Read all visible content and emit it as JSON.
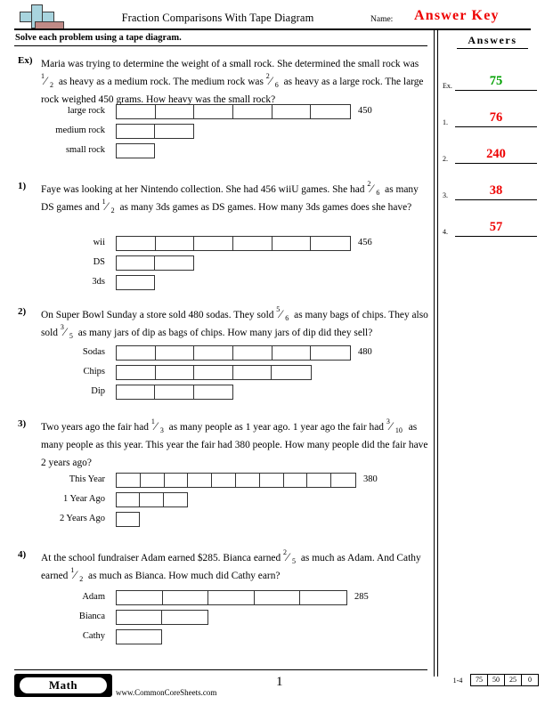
{
  "header": {
    "title": "Fraction Comparisons With Tape Diagram",
    "name_label": "Name:",
    "answer_key_label": "Answer Key",
    "logo_name": "commoncoresheets-logo"
  },
  "instruction": "Solve each problem using a tape diagram.",
  "answers": {
    "title": "Answers",
    "rows": [
      {
        "num": "Ex.",
        "value": "75",
        "color": "#00a000"
      },
      {
        "num": "1.",
        "value": "76",
        "color": "#ee0000"
      },
      {
        "num": "2.",
        "value": "240",
        "color": "#ee0000"
      },
      {
        "num": "3.",
        "value": "38",
        "color": "#ee0000"
      },
      {
        "num": "4.",
        "value": "57",
        "color": "#ee0000"
      }
    ]
  },
  "problems": [
    {
      "num": "Ex)",
      "text_parts": [
        {
          "t": "Maria was trying to determine the weight of a small rock. She determined the small rock was "
        },
        {
          "f": {
            "n": "1",
            "d": "2"
          }
        },
        {
          "t": " as heavy as a medium rock. The medium rock was "
        },
        {
          "f": {
            "n": "2",
            "d": "6"
          }
        },
        {
          "t": " as heavy as a large rock. The large rock weighed 450 grams. How heavy was the small rock?"
        }
      ],
      "diagram": {
        "rows": [
          {
            "label": "large rock",
            "cells": 6,
            "value": "450"
          },
          {
            "label": "medium rock",
            "cells": 2,
            "value": ""
          },
          {
            "label": "small rock",
            "cells": 1,
            "value": ""
          }
        ]
      }
    },
    {
      "num": "1)",
      "text_parts": [
        {
          "t": "Faye was looking at her Nintendo collection. She had 456 wiiU games. She had "
        },
        {
          "f": {
            "n": "2",
            "d": "6"
          }
        },
        {
          "t": " as many DS games and "
        },
        {
          "f": {
            "n": "1",
            "d": "2"
          }
        },
        {
          "t": " as many 3ds games as DS games. How many 3ds games does she have?"
        }
      ],
      "diagram": {
        "rows": [
          {
            "label": "wii",
            "cells": 6,
            "value": "456"
          },
          {
            "label": "DS",
            "cells": 2,
            "value": ""
          },
          {
            "label": "3ds",
            "cells": 1,
            "value": ""
          }
        ]
      }
    },
    {
      "num": "2)",
      "text_parts": [
        {
          "t": "On Super Bowl Sunday a store sold 480 sodas. They sold "
        },
        {
          "f": {
            "n": "5",
            "d": "6"
          }
        },
        {
          "t": " as many bags of chips. They also sold "
        },
        {
          "f": {
            "n": "3",
            "d": "5"
          }
        },
        {
          "t": " as many jars of dip as bags of chips. How many jars of dip did they sell?"
        }
      ],
      "diagram": {
        "rows": [
          {
            "label": "Sodas",
            "cells": 6,
            "value": "480"
          },
          {
            "label": "Chips",
            "cells": 5,
            "value": ""
          },
          {
            "label": "Dip",
            "cells": 3,
            "value": ""
          }
        ]
      }
    },
    {
      "num": "3)",
      "text_parts": [
        {
          "t": "Two years ago the fair had "
        },
        {
          "f": {
            "n": "1",
            "d": "3"
          }
        },
        {
          "t": " as many people as 1 year ago. 1 year ago the fair had "
        },
        {
          "f": {
            "n": "3",
            "d": "10"
          }
        },
        {
          "t": " as many people as this year. This year the fair had 380 people. How many people did the fair have 2 years ago?"
        }
      ],
      "diagram": {
        "rows": [
          {
            "label": "This Year",
            "cells": 10,
            "value": "380"
          },
          {
            "label": "1 Year Ago",
            "cells": 3,
            "value": ""
          },
          {
            "label": "2 Years Ago",
            "cells": 1,
            "value": ""
          }
        ]
      }
    },
    {
      "num": "4)",
      "text_parts": [
        {
          "t": "At the school fundraiser Adam earned $285. Bianca earned "
        },
        {
          "f": {
            "n": "2",
            "d": "5"
          }
        },
        {
          "t": " as much as Adam. And Cathy earned "
        },
        {
          "f": {
            "n": "1",
            "d": "2"
          }
        },
        {
          "t": " as much as Bianca. How much did Cathy earn?"
        }
      ],
      "diagram": {
        "rows": [
          {
            "label": "Adam",
            "cells": 5,
            "value": "285"
          },
          {
            "label": "Bianca",
            "cells": 2,
            "value": ""
          },
          {
            "label": "Cathy",
            "cells": 1,
            "value": ""
          }
        ]
      }
    }
  ],
  "footer": {
    "subject_badge": "Math",
    "site_url": "www.CommonCoreSheets.com",
    "page_number": "1",
    "score_range": "1-4",
    "score_values": [
      "75",
      "50",
      "25",
      "0"
    ]
  }
}
